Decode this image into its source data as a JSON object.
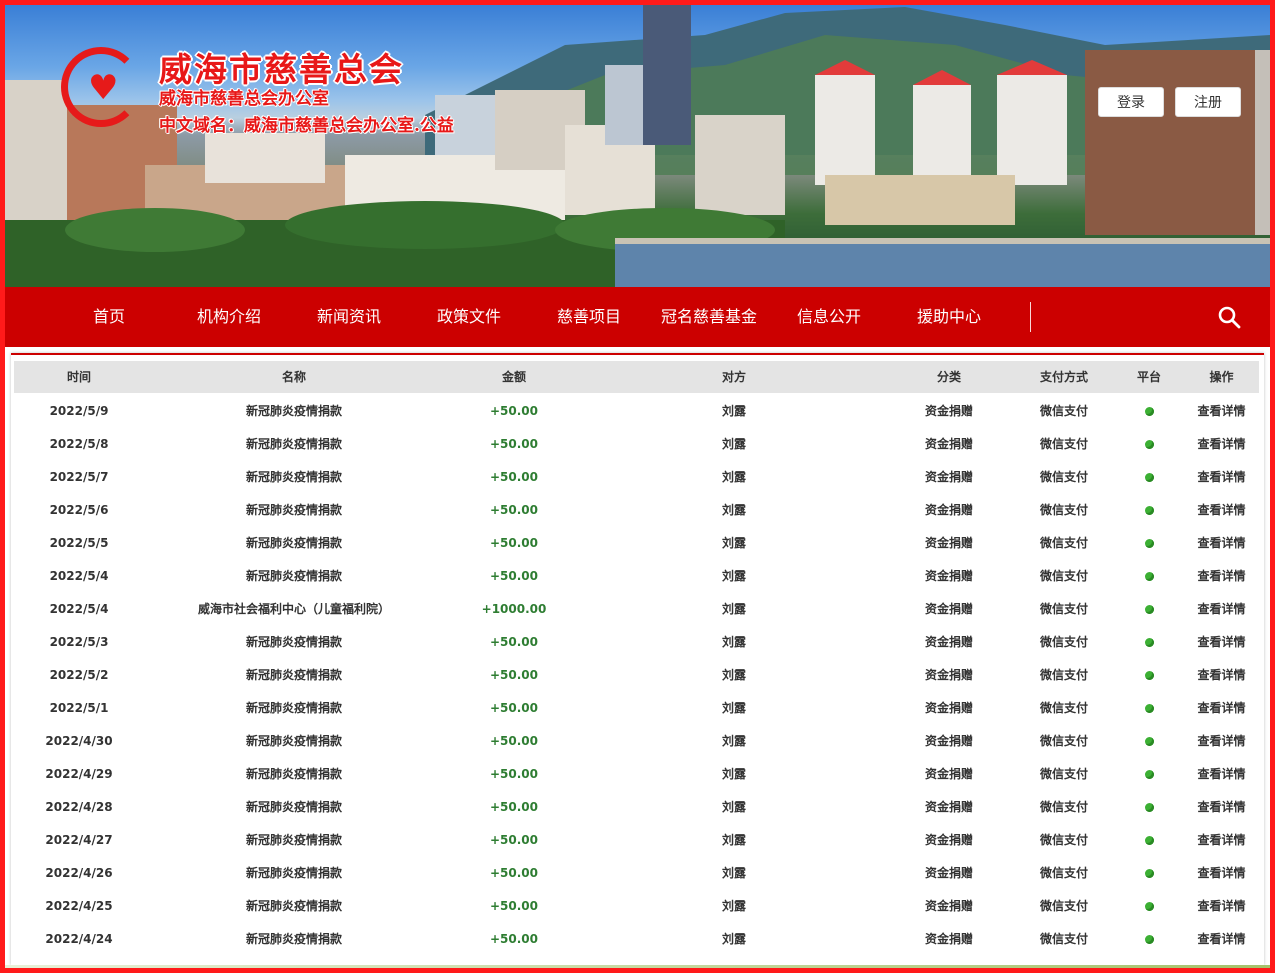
{
  "header": {
    "title": "威海市慈善总会",
    "subtitle1": "威海市慈善总会办公室",
    "subtitle2": "中文域名：威海市慈善总会办公室.公益",
    "login_label": "登录",
    "register_label": "注册"
  },
  "nav": {
    "items": [
      "首页",
      "机构介绍",
      "新闻资讯",
      "政策文件",
      "慈善项目",
      "冠名慈善基金",
      "信息公开",
      "援助中心"
    ]
  },
  "table": {
    "headers": [
      "时间",
      "名称",
      "金额",
      "对方",
      "分类",
      "支付方式",
      "平台",
      "操作"
    ],
    "rows": [
      {
        "date": "2022/5/9",
        "name": "新冠肺炎疫情捐款",
        "amount": "+50.00",
        "party": "刘露",
        "category": "资金捐赠",
        "payment": "微信支付",
        "platform": "wechat-icon",
        "action": "查看详情"
      },
      {
        "date": "2022/5/8",
        "name": "新冠肺炎疫情捐款",
        "amount": "+50.00",
        "party": "刘露",
        "category": "资金捐赠",
        "payment": "微信支付",
        "platform": "wechat-icon",
        "action": "查看详情"
      },
      {
        "date": "2022/5/7",
        "name": "新冠肺炎疫情捐款",
        "amount": "+50.00",
        "party": "刘露",
        "category": "资金捐赠",
        "payment": "微信支付",
        "platform": "wechat-icon",
        "action": "查看详情"
      },
      {
        "date": "2022/5/6",
        "name": "新冠肺炎疫情捐款",
        "amount": "+50.00",
        "party": "刘露",
        "category": "资金捐赠",
        "payment": "微信支付",
        "platform": "wechat-icon",
        "action": "查看详情"
      },
      {
        "date": "2022/5/5",
        "name": "新冠肺炎疫情捐款",
        "amount": "+50.00",
        "party": "刘露",
        "category": "资金捐赠",
        "payment": "微信支付",
        "platform": "wechat-icon",
        "action": "查看详情"
      },
      {
        "date": "2022/5/4",
        "name": "新冠肺炎疫情捐款",
        "amount": "+50.00",
        "party": "刘露",
        "category": "资金捐赠",
        "payment": "微信支付",
        "platform": "wechat-icon",
        "action": "查看详情"
      },
      {
        "date": "2022/5/4",
        "name": "威海市社会福利中心（儿童福利院）",
        "amount": "+1000.00",
        "party": "刘露",
        "category": "资金捐赠",
        "payment": "微信支付",
        "platform": "wechat-icon",
        "action": "查看详情"
      },
      {
        "date": "2022/5/3",
        "name": "新冠肺炎疫情捐款",
        "amount": "+50.00",
        "party": "刘露",
        "category": "资金捐赠",
        "payment": "微信支付",
        "platform": "wechat-icon",
        "action": "查看详情"
      },
      {
        "date": "2022/5/2",
        "name": "新冠肺炎疫情捐款",
        "amount": "+50.00",
        "party": "刘露",
        "category": "资金捐赠",
        "payment": "微信支付",
        "platform": "wechat-icon",
        "action": "查看详情"
      },
      {
        "date": "2022/5/1",
        "name": "新冠肺炎疫情捐款",
        "amount": "+50.00",
        "party": "刘露",
        "category": "资金捐赠",
        "payment": "微信支付",
        "platform": "wechat-icon",
        "action": "查看详情"
      },
      {
        "date": "2022/4/30",
        "name": "新冠肺炎疫情捐款",
        "amount": "+50.00",
        "party": "刘露",
        "category": "资金捐赠",
        "payment": "微信支付",
        "platform": "wechat-icon",
        "action": "查看详情"
      },
      {
        "date": "2022/4/29",
        "name": "新冠肺炎疫情捐款",
        "amount": "+50.00",
        "party": "刘露",
        "category": "资金捐赠",
        "payment": "微信支付",
        "platform": "wechat-icon",
        "action": "查看详情"
      },
      {
        "date": "2022/4/28",
        "name": "新冠肺炎疫情捐款",
        "amount": "+50.00",
        "party": "刘露",
        "category": "资金捐赠",
        "payment": "微信支付",
        "platform": "wechat-icon",
        "action": "查看详情"
      },
      {
        "date": "2022/4/27",
        "name": "新冠肺炎疫情捐款",
        "amount": "+50.00",
        "party": "刘露",
        "category": "资金捐赠",
        "payment": "微信支付",
        "platform": "wechat-icon",
        "action": "查看详情"
      },
      {
        "date": "2022/4/26",
        "name": "新冠肺炎疫情捐款",
        "amount": "+50.00",
        "party": "刘露",
        "category": "资金捐赠",
        "payment": "微信支付",
        "platform": "wechat-icon",
        "action": "查看详情"
      },
      {
        "date": "2022/4/25",
        "name": "新冠肺炎疫情捐款",
        "amount": "+50.00",
        "party": "刘露",
        "category": "资金捐赠",
        "payment": "微信支付",
        "platform": "wechat-icon",
        "action": "查看详情"
      },
      {
        "date": "2022/4/24",
        "name": "新冠肺炎疫情捐款",
        "amount": "+50.00",
        "party": "刘露",
        "category": "资金捐赠",
        "payment": "微信支付",
        "platform": "wechat-icon",
        "action": "查看详情"
      }
    ]
  },
  "colors": {
    "brand_red": "#cc0000",
    "frame_red": "#ff1a1a",
    "amount_green": "#2e7d32",
    "wechat_green": "#3cb034"
  }
}
